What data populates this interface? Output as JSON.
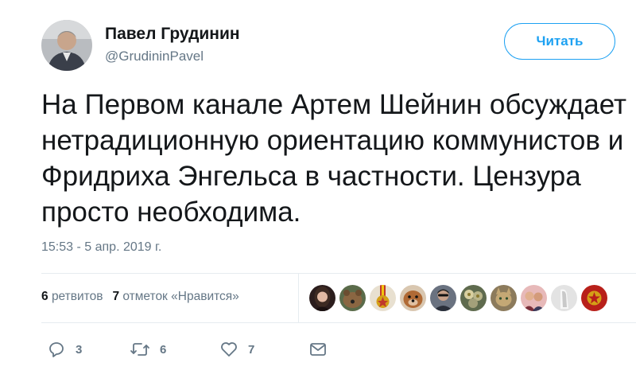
{
  "user": {
    "name": "Павел Грудинин",
    "handle": "@GrudininPavel"
  },
  "follow_button": {
    "label": "Читать"
  },
  "tweet": {
    "text": "На Первом канале Артем Шейнин обсуждает нетрадиционную ориентацию коммунистов и Фридриха Энгельса в частности. Цензура просто необходима.",
    "timestamp": "15:53 - 5 апр. 2019 г."
  },
  "stats": {
    "retweets_count": "6",
    "retweets_label": "ретвитов",
    "likes_count": "7",
    "likes_label": "отметок «Нравится»"
  },
  "likers": [
    {
      "icon": "avatar-woman",
      "bg": "#3b2a2a"
    },
    {
      "icon": "avatar-dog",
      "bg": "#7a5a3c"
    },
    {
      "icon": "avatar-medal",
      "bg": "#c0392b"
    },
    {
      "icon": "avatar-dog-face",
      "bg": "#b06a35"
    },
    {
      "icon": "avatar-man-sunglasses",
      "bg": "#4a4f5a"
    },
    {
      "icon": "avatar-flowers",
      "bg": "#6e6a4e"
    },
    {
      "icon": "avatar-cat",
      "bg": "#8a7a5a"
    },
    {
      "icon": "avatar-couple",
      "bg": "#c48a8a"
    },
    {
      "icon": "avatar-figure",
      "bg": "#cfcfcf"
    },
    {
      "icon": "avatar-emblem",
      "bg": "#b8201a"
    }
  ],
  "actions": {
    "reply": {
      "icon": "reply-icon",
      "count": "3"
    },
    "retweet": {
      "icon": "retweet-icon",
      "count": "6"
    },
    "like": {
      "icon": "heart-icon",
      "count": "7"
    },
    "message": {
      "icon": "envelope-icon"
    }
  },
  "colors": {
    "accent": "#1da1f2",
    "muted": "#657786",
    "text": "#14171a",
    "divider": "#e6ecf0"
  }
}
